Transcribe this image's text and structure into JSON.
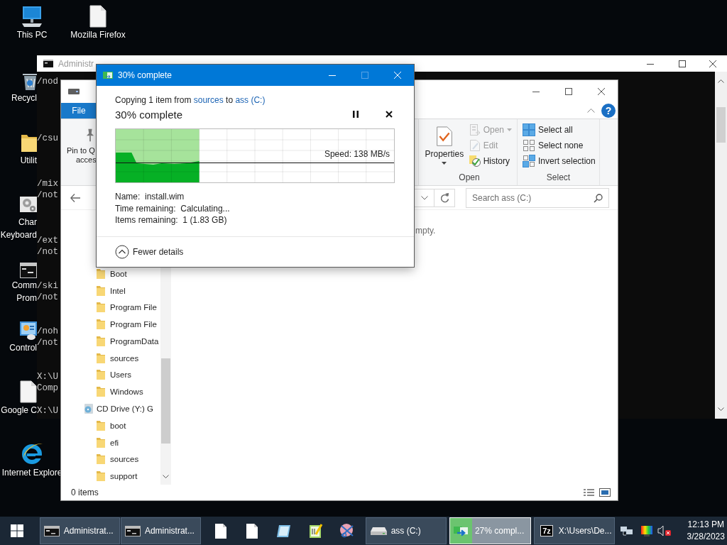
{
  "desktop_icons": [
    {
      "kind": "pc",
      "lines": [
        "This PC"
      ]
    },
    {
      "kind": "file",
      "lines": [
        "Mozilla Firefox"
      ]
    },
    {
      "kind": "recycle",
      "lines": [
        "Recycl"
      ]
    },
    {
      "kind": "folder",
      "lines": [
        "Utilit"
      ]
    },
    {
      "kind": "gears",
      "lines": [
        "Char",
        "Keyboard"
      ]
    },
    {
      "kind": "console",
      "lines": [
        "Comm",
        "Prom"
      ]
    },
    {
      "kind": "control",
      "lines": [
        "Control"
      ]
    },
    {
      "kind": "file",
      "lines": [
        "Google C"
      ]
    },
    {
      "kind": "browser",
      "lines": [
        "Internet Explore"
      ]
    }
  ],
  "console_window": {
    "title": "Administr",
    "blocks": [
      [
        "/nod"
      ],
      [
        "/csu"
      ],
      [
        "/mix",
        "/not"
      ],
      [
        "/ext",
        "/not"
      ],
      [
        "/ski",
        "/not"
      ],
      [
        "/noh",
        "/not"
      ],
      [
        "X:\\U",
        "Comp"
      ],
      [
        "X:\\U"
      ]
    ]
  },
  "explorer_window": {
    "file_tab": "File",
    "help": "?",
    "ribbon": {
      "pin_button": [
        "Pin to Q",
        "acces"
      ],
      "groups": [
        {
          "label": "Open",
          "buttons": [
            {
              "kind": "large",
              "label": "Properties",
              "disabled": false,
              "dropdown": true
            },
            {
              "kind": "small",
              "label": "Open",
              "disabled": true,
              "dropdown": true
            },
            {
              "kind": "small",
              "label": "Edit",
              "disabled": true,
              "dropdown": false
            },
            {
              "kind": "small",
              "label": "History",
              "disabled": false,
              "dropdown": false
            }
          ]
        },
        {
          "label": "Select",
          "buttons": [
            {
              "kind": "small",
              "label": "Select all",
              "disabled": false,
              "dropdown": false
            },
            {
              "kind": "small",
              "label": "Select none",
              "disabled": false,
              "dropdown": false
            },
            {
              "kind": "small",
              "label": "Invert selection",
              "disabled": false,
              "dropdown": false
            }
          ]
        }
      ]
    },
    "search": {
      "placeholder": "Search ass (C:)"
    },
    "content_text": "mpty.",
    "nav_items": [
      {
        "kind": "folder",
        "label": "Boot"
      },
      {
        "kind": "folder",
        "label": "Intel"
      },
      {
        "kind": "folder",
        "label": "Program File"
      },
      {
        "kind": "folder",
        "label": "Program File"
      },
      {
        "kind": "folder",
        "label": "ProgramData"
      },
      {
        "kind": "folder",
        "label": "sources"
      },
      {
        "kind": "folder",
        "label": "Users"
      },
      {
        "kind": "folder",
        "label": "Windows"
      },
      {
        "kind": "drive",
        "label": "CD Drive (Y:) G",
        "children": [
          {
            "kind": "folder",
            "label": "boot"
          },
          {
            "kind": "folder",
            "label": "efi"
          },
          {
            "kind": "folder",
            "label": "sources"
          },
          {
            "kind": "folder",
            "label": "support"
          }
        ]
      }
    ],
    "status": "0 items"
  },
  "copy_dialog": {
    "title": "30% complete",
    "window_buttons": [
      {
        "kind": "minimize",
        "disabled": false
      },
      {
        "kind": "maximize",
        "disabled": true
      },
      {
        "kind": "close",
        "disabled": false
      }
    ],
    "status": {
      "prefix": "Copying 1 item from",
      "source": "sources",
      "middle": "to",
      "destination": "ass (C:)"
    },
    "heading": "30% complete",
    "progress": {
      "level": 0.3
    },
    "speed": "Speed: 138 MB/s",
    "details": [
      "Name:  install.wim",
      "Time remaining:  Calculating...",
      "Items remaining:  1 (1.83 GB)"
    ],
    "toggle": "Fewer details"
  },
  "taskbar": {
    "items": [
      {
        "kind": "console",
        "label": "Administrat...",
        "selected": false
      },
      {
        "kind": "console",
        "label": "Administrat...",
        "selected": false
      },
      {
        "kind": "file",
        "selected": false
      },
      {
        "kind": "file",
        "selected": false
      },
      {
        "kind": "notepad",
        "selected": false
      },
      {
        "kind": "notepadpp",
        "selected": false
      },
      {
        "kind": "snip",
        "selected": false
      },
      {
        "kind": "drive",
        "label": "ass (C:)",
        "selected": false
      },
      {
        "kind": "copy",
        "label": "27% compl...",
        "selected": true,
        "level": 0.27
      },
      {
        "kind": "archive",
        "icon_text": "7z",
        "label": "X:\\Users\\De...",
        "selected": false
      }
    ],
    "tray": {
      "volume_muted": true,
      "time": "12:13 PM",
      "date": "3/28/2023"
    }
  }
}
